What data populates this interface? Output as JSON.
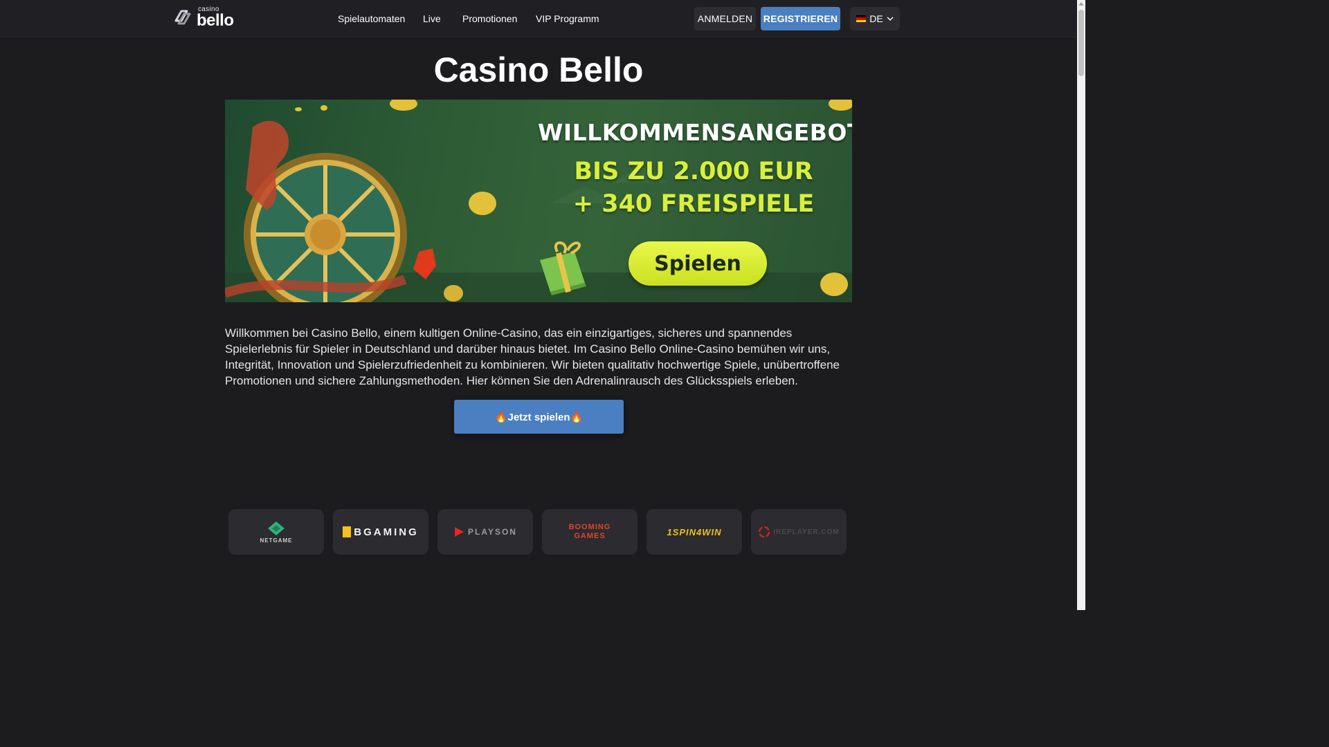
{
  "header": {
    "logo": {
      "top_text": "casino",
      "main_text": "bello",
      "icon": "casino-bello-logo-icon"
    },
    "nav": [
      "Spielautomaten",
      "Live",
      "Promotionen",
      "VIP Programm"
    ],
    "login_label": "ANMELDEN",
    "register_label": "REGISTRIEREN",
    "language": {
      "code": "DE",
      "flag_icon": "german-flag-icon",
      "chevron_icon": "chevron-down-icon"
    }
  },
  "main": {
    "title": "Casino Bello",
    "banner": {
      "headline": "WILLKOMMENSANGEBOT",
      "offer_line1": "BIS ZU 2.000 EUR",
      "offer_line2": "+ 340 FREISPIELE",
      "button_label": "Spielen"
    },
    "intro_text": "Willkommen bei Casino Bello, einem kultigen Online-Casino, das ein einzigartiges, sicheres und spannendes Spielerlebnis für Spieler in Deutschland und darüber hinaus bietet. Im Casino Bello Online-Casino bemühen wir uns, Integrität, Innovation und Spielerzufriedenheit zu kombinieren. Wir bieten qualitativ hochwertige Spiele, unübertroffene Promotionen und sichere Zahlungsmethoden. Hier können Sie den Adrenalinrausch des Glücksspiels erleben.",
    "cta_label": "🔥Jetzt spielen🔥"
  },
  "providers": [
    {
      "name": "NETGAME",
      "icon": "netgame-logo-icon"
    },
    {
      "name": "BGAMING",
      "icon": "bgaming-logo-icon"
    },
    {
      "name": "PLAYSON",
      "icon": "playson-logo-icon"
    },
    {
      "name": "BOOMING GAMES",
      "icon": "booming-games-logo-icon"
    },
    {
      "name": "1SPIN4WIN",
      "icon": "1spin4win-logo-icon"
    },
    {
      "name": "IREPLAYER.COM",
      "icon": "ireplayer-logo-icon"
    }
  ],
  "colors": {
    "background": "#1c1c1f",
    "header": "#202024",
    "accent_blue": "#4a7fc1",
    "banner_yellow": "#d8f03a"
  }
}
